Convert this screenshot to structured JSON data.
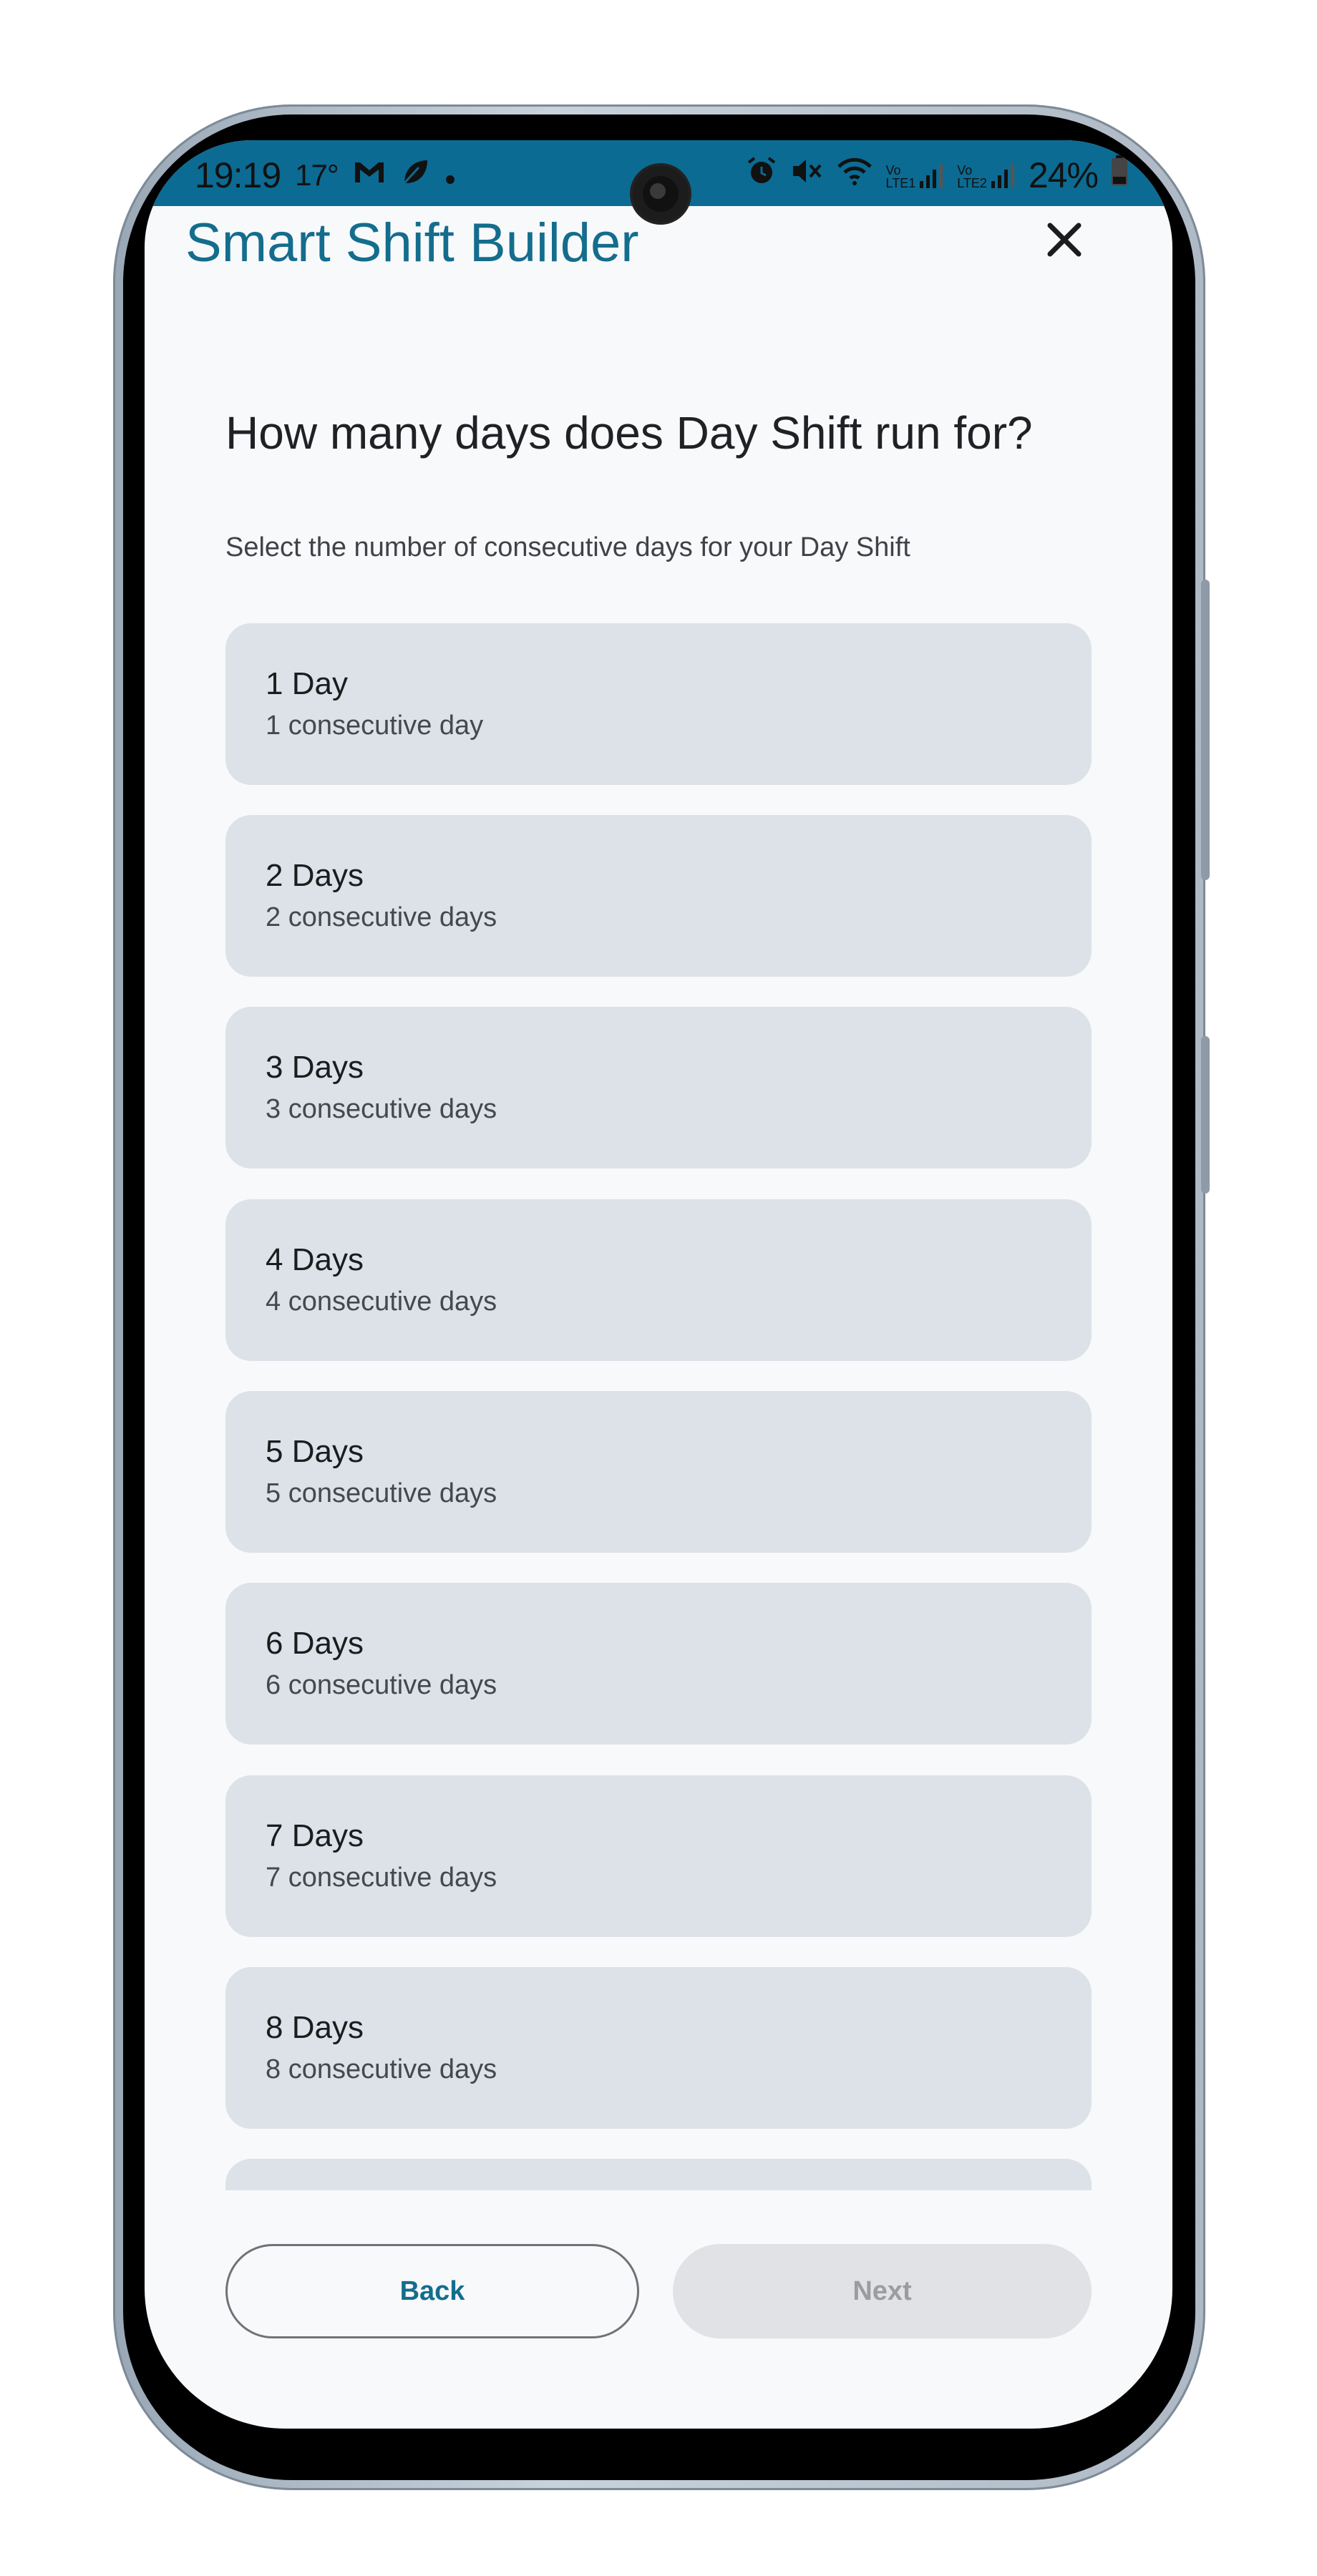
{
  "status_bar": {
    "time": "19:19",
    "temperature": "17°",
    "battery": "24%",
    "icons_left": [
      "temperature-icon",
      "gmail-icon",
      "leaf-icon",
      "dot-icon"
    ],
    "icons_right": [
      "alarm-icon",
      "mute-icon",
      "wifi-icon",
      "signal-lte1-icon",
      "signal-lte2-icon",
      "battery-icon"
    ],
    "lte1_label": "LTE1",
    "lte2_label": "LTE2",
    "volte_label": "Vo"
  },
  "header": {
    "title": "Smart Shift Builder",
    "close_icon": "close-icon"
  },
  "question": {
    "heading": "How many days does Day Shift run for?",
    "description": "Select the number of consecutive days for your Day Shift"
  },
  "options": [
    {
      "label": "1 Day",
      "sublabel": "1 consecutive day"
    },
    {
      "label": "2 Days",
      "sublabel": "2 consecutive days"
    },
    {
      "label": "3 Days",
      "sublabel": "3 consecutive days"
    },
    {
      "label": "4 Days",
      "sublabel": "4 consecutive days"
    },
    {
      "label": "5 Days",
      "sublabel": "5 consecutive days"
    },
    {
      "label": "6 Days",
      "sublabel": "6 consecutive days"
    },
    {
      "label": "7 Days",
      "sublabel": "7 consecutive days"
    },
    {
      "label": "8 Days",
      "sublabel": "8 consecutive days"
    },
    {
      "label": "",
      "sublabel": ""
    }
  ],
  "footer": {
    "back_label": "Back",
    "next_label": "Next"
  },
  "colors": {
    "accent": "#146d8d",
    "status_bar": "#0b6b93",
    "option_bg": "#dce2e7",
    "next_disabled_bg": "#e1e2e5"
  }
}
